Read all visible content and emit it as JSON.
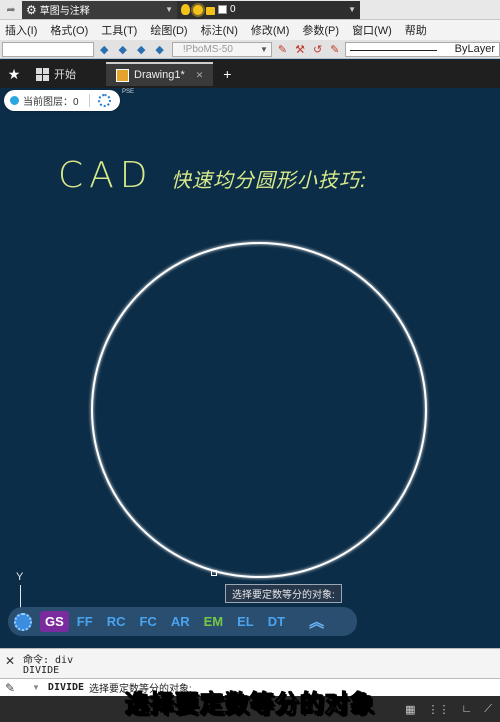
{
  "quick_access": {
    "workspace": "草图与注释",
    "layer_current": "0"
  },
  "menubar": {
    "items": [
      "插入(I)",
      "格式(O)",
      "工具(T)",
      "绘图(D)",
      "标注(N)",
      "修改(M)",
      "参数(P)",
      "窗口(W)",
      "帮助"
    ]
  },
  "properties": {
    "plotstyle": "!PboMS-50",
    "lineweight": "ByLayer"
  },
  "tabs": {
    "start": "开始",
    "drawing": "Drawing1*",
    "add": "+"
  },
  "layer_pill": {
    "label": "当前图层：0"
  },
  "pse_label": "PSE",
  "canvas": {
    "title_main": "CAD",
    "title_tail": "快速均分圆形小技巧:",
    "ucs_label": "Y",
    "tooltip": "选择要定数等分的对象:"
  },
  "osnap_bar": {
    "gs": "GS",
    "options": [
      "FF",
      "RC",
      "FC",
      "AR",
      "EM",
      "EL",
      "DT"
    ]
  },
  "command": {
    "history_line1": "命令: div",
    "history_line2": "DIVIDE",
    "current_cmd": "DIVIDE",
    "current_text": "选择要定数等分的对象:"
  },
  "caption": "选择要定数等分的对象",
  "colors": {
    "canvas": "#0c2d47",
    "title": "#d7e98a",
    "circle": "#ffffff"
  }
}
